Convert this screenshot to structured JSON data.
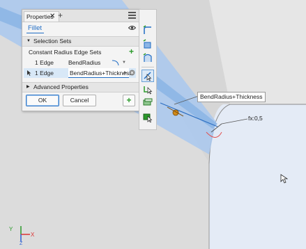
{
  "panel": {
    "tab_title": "Properties",
    "tab_close": "✕",
    "tab_add": "+",
    "feature_name": "Fillet",
    "selection_sets": {
      "heading": "Selection Sets",
      "subheading": "Constant Radius Edge Sets",
      "rows": [
        {
          "edges": "1 Edge",
          "radius": "BendRadius"
        },
        {
          "edges": "1 Edge",
          "radius": "BendRadius+Thickness"
        }
      ]
    },
    "advanced_heading": "Advanced Properties",
    "ok_label": "OK",
    "cancel_label": "Cancel",
    "add_label": "+"
  },
  "toolbar": {
    "tools": [
      "fillet-edge-icon",
      "fillet-face-icon",
      "fillet-full-round-icon",
      "edge-select-icon",
      "loop-select-icon",
      "feature-select-icon",
      "solid-select-icon"
    ]
  },
  "viewport": {
    "callout_text": "BendRadius+Thickness",
    "fx_label": "fx:0,5",
    "triad_axes": {
      "x": "X",
      "y": "Y",
      "z": "Z"
    }
  },
  "colors": {
    "accent": "#1f6cc4",
    "background": "#dcdcdc",
    "selected_edge": "#7fb0e8",
    "add_green": "#2a9a2a"
  }
}
